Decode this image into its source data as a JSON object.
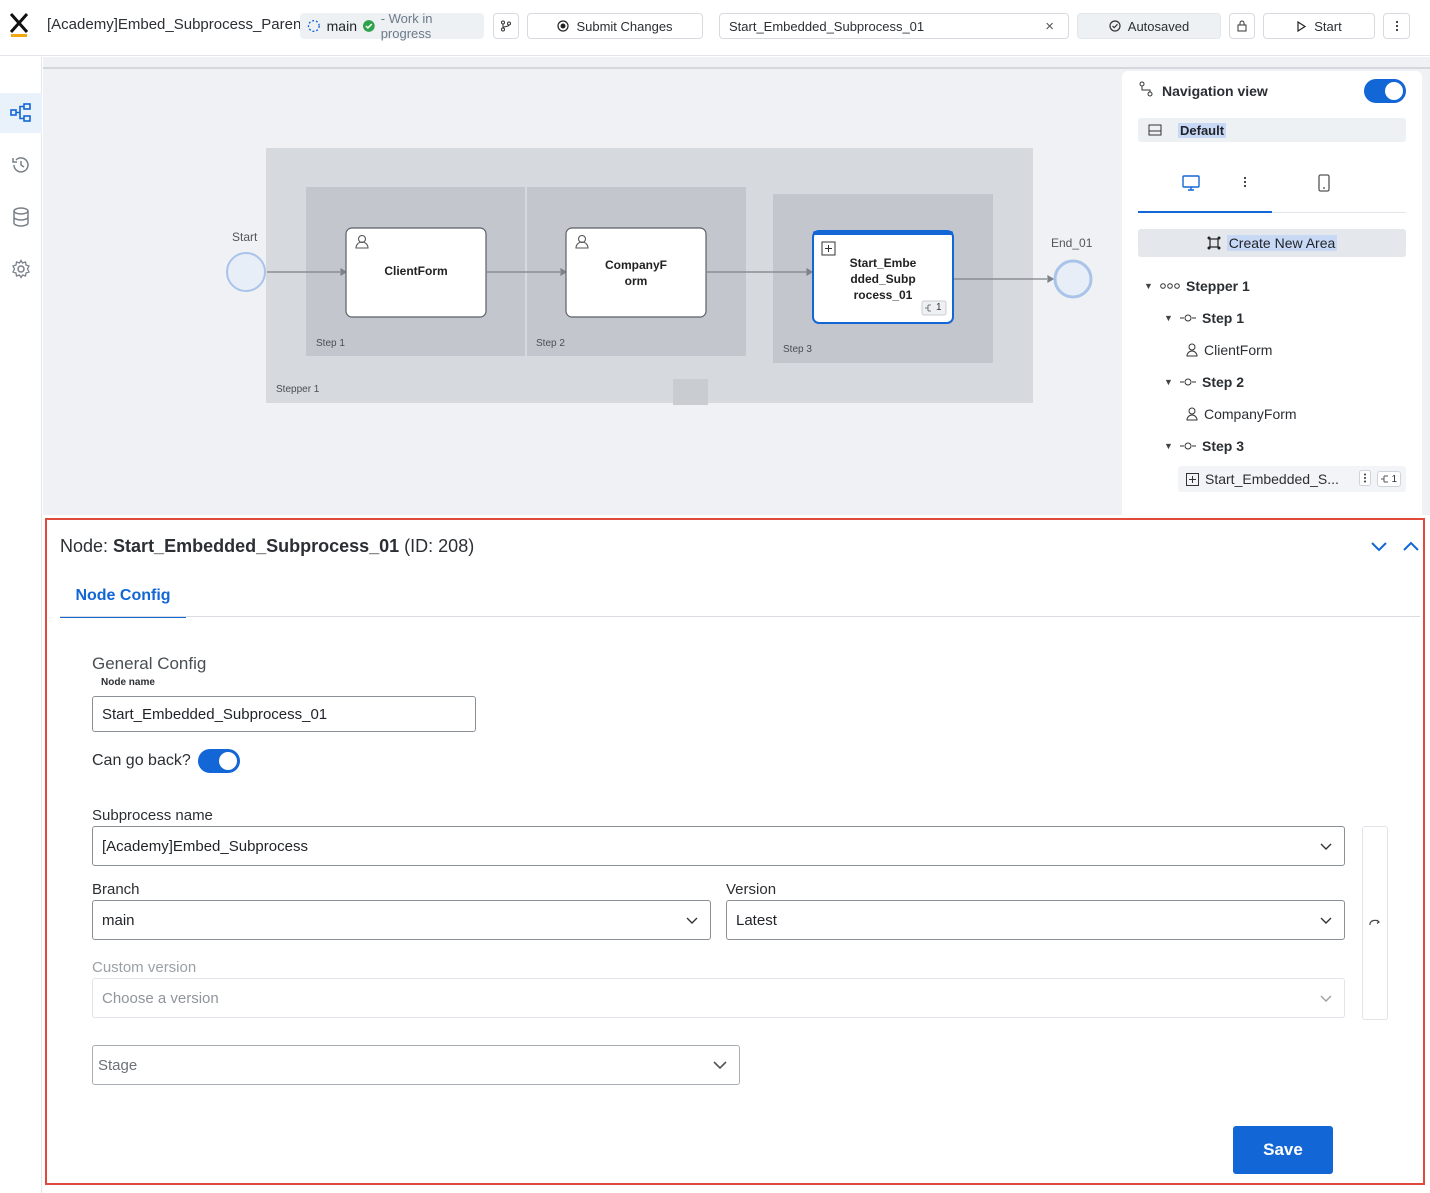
{
  "topbar": {
    "app_title": "[Academy]Embed_Subprocess_Parent",
    "branch": "main",
    "status": "- Work in progress",
    "submit_label": "Submit Changes",
    "node_search_value": "Start_Embedded_Subprocess_01",
    "autosave_label": "Autosaved",
    "start_label": "Start"
  },
  "sidebar": {
    "items": [
      {
        "icon": "process-diagram-icon",
        "active": true
      },
      {
        "icon": "history-icon",
        "active": false
      },
      {
        "icon": "database-icon",
        "active": false
      },
      {
        "icon": "settings-icon",
        "active": false
      }
    ]
  },
  "diagram": {
    "start_label": "Start",
    "end_label": "End_01",
    "stepper_label": "Stepper 1",
    "steps": [
      {
        "label": "Step 1",
        "node": "ClientForm"
      },
      {
        "label": "Step 2",
        "node_line1": "CompanyF",
        "node_line2": "orm"
      },
      {
        "label": "Step 3",
        "node_line1": "Start_Embe",
        "node_line2": "dded_Subp",
        "node_line3": "rocess_01",
        "badge": "1"
      }
    ]
  },
  "navigation": {
    "title": "Navigation view",
    "default_label": "Default",
    "create_area_label": "Create New Area",
    "tree": {
      "stepper": "Stepper 1",
      "step1": "Step 1",
      "step1_child": "ClientForm",
      "step2": "Step 2",
      "step2_child": "CompanyForm",
      "step3": "Step 3",
      "step3_child": "Start_Embedded_S...",
      "step3_badge": "1"
    }
  },
  "details": {
    "node_prefix": "Node: ",
    "node_name": "Start_Embedded_Subprocess_01",
    "node_id": " (ID: 208)",
    "tab_label": "Node Config",
    "section_title": "General Config",
    "node_name_label": "Node name",
    "node_name_value": "Start_Embedded_Subprocess_01",
    "can_go_back_label": "Can go back?",
    "subprocess_label": "Subprocess name",
    "subprocess_value": "[Academy]Embed_Subprocess",
    "branch_label": "Branch",
    "branch_value": "main",
    "version_label": "Version",
    "version_value": "Latest",
    "custom_version_label": "Custom version",
    "custom_version_placeholder": "Choose a version",
    "stage_placeholder": "Stage",
    "save_label": "Save"
  },
  "colors": {
    "accent": "#1366d6",
    "highlight_border": "#e04a3c",
    "status_green": "#2fa24b"
  }
}
